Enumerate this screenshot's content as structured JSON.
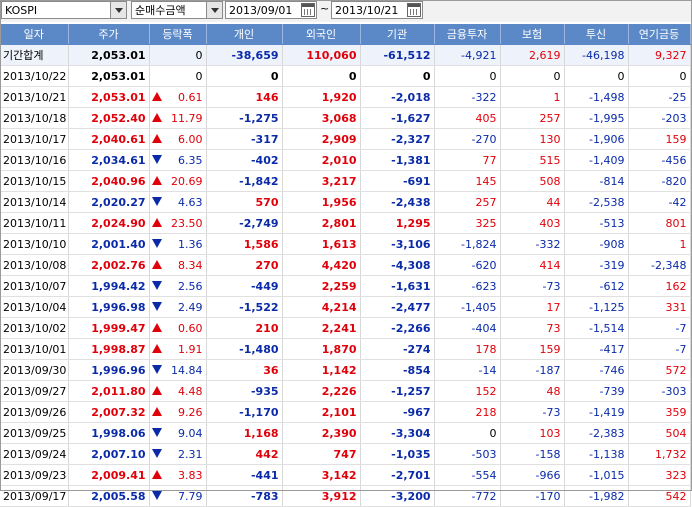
{
  "toolbar": {
    "market": "KOSPI",
    "type": "순매수금액",
    "start_date": "2013/09/01",
    "end_date": "2013/10/21",
    "separator": "~"
  },
  "columns": [
    "일자",
    "주가",
    "등락폭",
    "개인",
    "외국인",
    "기관",
    "금융투자",
    "보험",
    "투신",
    "연기금등"
  ],
  "colors": {
    "up": "#e0000a",
    "down": "#0a2aa8",
    "header": "#5b88c6"
  },
  "rows": [
    {
      "date": "기간합계",
      "price": "2,053.01",
      "dir": "",
      "chg": "0",
      "ind": "-38,659",
      "frn": "110,060",
      "inst": "-61,512",
      "fin": "-4,921",
      "ins": "2,619",
      "trust": "-46,198",
      "pens": "9,327"
    },
    {
      "date": "2013/10/22",
      "price": "2,053.01",
      "dir": "",
      "chg": "0",
      "ind": "0",
      "frn": "0",
      "inst": "0",
      "fin": "0",
      "ins": "0",
      "trust": "0",
      "pens": "0"
    },
    {
      "date": "2013/10/21",
      "price": "2,053.01",
      "dir": "up",
      "chg": "0.61",
      "ind": "146",
      "frn": "1,920",
      "inst": "-2,018",
      "fin": "-322",
      "ins": "1",
      "trust": "-1,498",
      "pens": "-25"
    },
    {
      "date": "2013/10/18",
      "price": "2,052.40",
      "dir": "up",
      "chg": "11.79",
      "ind": "-1,275",
      "frn": "3,068",
      "inst": "-1,627",
      "fin": "405",
      "ins": "257",
      "trust": "-1,995",
      "pens": "-203"
    },
    {
      "date": "2013/10/17",
      "price": "2,040.61",
      "dir": "up",
      "chg": "6.00",
      "ind": "-317",
      "frn": "2,909",
      "inst": "-2,327",
      "fin": "-270",
      "ins": "130",
      "trust": "-1,906",
      "pens": "159"
    },
    {
      "date": "2013/10/16",
      "price": "2,034.61",
      "dir": "down",
      "chg": "6.35",
      "ind": "-402",
      "frn": "2,010",
      "inst": "-1,381",
      "fin": "77",
      "ins": "515",
      "trust": "-1,409",
      "pens": "-456"
    },
    {
      "date": "2013/10/15",
      "price": "2,040.96",
      "dir": "up",
      "chg": "20.69",
      "ind": "-1,842",
      "frn": "3,217",
      "inst": "-691",
      "fin": "145",
      "ins": "508",
      "trust": "-814",
      "pens": "-820"
    },
    {
      "date": "2013/10/14",
      "price": "2,020.27",
      "dir": "down",
      "chg": "4.63",
      "ind": "570",
      "frn": "1,956",
      "inst": "-2,438",
      "fin": "257",
      "ins": "44",
      "trust": "-2,538",
      "pens": "-42"
    },
    {
      "date": "2013/10/11",
      "price": "2,024.90",
      "dir": "up",
      "chg": "23.50",
      "ind": "-2,749",
      "frn": "2,801",
      "inst": "1,295",
      "fin": "325",
      "ins": "403",
      "trust": "-513",
      "pens": "801"
    },
    {
      "date": "2013/10/10",
      "price": "2,001.40",
      "dir": "down",
      "chg": "1.36",
      "ind": "1,586",
      "frn": "1,613",
      "inst": "-3,106",
      "fin": "-1,824",
      "ins": "-332",
      "trust": "-908",
      "pens": "1"
    },
    {
      "date": "2013/10/08",
      "price": "2,002.76",
      "dir": "up",
      "chg": "8.34",
      "ind": "270",
      "frn": "4,420",
      "inst": "-4,308",
      "fin": "-620",
      "ins": "414",
      "trust": "-319",
      "pens": "-2,348"
    },
    {
      "date": "2013/10/07",
      "price": "1,994.42",
      "dir": "down",
      "chg": "2.56",
      "ind": "-449",
      "frn": "2,259",
      "inst": "-1,631",
      "fin": "-623",
      "ins": "-73",
      "trust": "-612",
      "pens": "162"
    },
    {
      "date": "2013/10/04",
      "price": "1,996.98",
      "dir": "down",
      "chg": "2.49",
      "ind": "-1,522",
      "frn": "4,214",
      "inst": "-2,477",
      "fin": "-1,405",
      "ins": "17",
      "trust": "-1,125",
      "pens": "331"
    },
    {
      "date": "2013/10/02",
      "price": "1,999.47",
      "dir": "up",
      "chg": "0.60",
      "ind": "210",
      "frn": "2,241",
      "inst": "-2,266",
      "fin": "-404",
      "ins": "73",
      "trust": "-1,514",
      "pens": "-7"
    },
    {
      "date": "2013/10/01",
      "price": "1,998.87",
      "dir": "up",
      "chg": "1.91",
      "ind": "-1,480",
      "frn": "1,870",
      "inst": "-274",
      "fin": "178",
      "ins": "159",
      "trust": "-417",
      "pens": "-7"
    },
    {
      "date": "2013/09/30",
      "price": "1,996.96",
      "dir": "down",
      "chg": "14.84",
      "ind": "36",
      "frn": "1,142",
      "inst": "-854",
      "fin": "-14",
      "ins": "-187",
      "trust": "-746",
      "pens": "572"
    },
    {
      "date": "2013/09/27",
      "price": "2,011.80",
      "dir": "up",
      "chg": "4.48",
      "ind": "-935",
      "frn": "2,226",
      "inst": "-1,257",
      "fin": "152",
      "ins": "48",
      "trust": "-739",
      "pens": "-303"
    },
    {
      "date": "2013/09/26",
      "price": "2,007.32",
      "dir": "up",
      "chg": "9.26",
      "ind": "-1,170",
      "frn": "2,101",
      "inst": "-967",
      "fin": "218",
      "ins": "-73",
      "trust": "-1,419",
      "pens": "359"
    },
    {
      "date": "2013/09/25",
      "price": "1,998.06",
      "dir": "down",
      "chg": "9.04",
      "ind": "1,168",
      "frn": "2,390",
      "inst": "-3,304",
      "fin": "0",
      "ins": "103",
      "trust": "-2,383",
      "pens": "504"
    },
    {
      "date": "2013/09/24",
      "price": "2,007.10",
      "dir": "down",
      "chg": "2.31",
      "ind": "442",
      "frn": "747",
      "inst": "-1,035",
      "fin": "-503",
      "ins": "-158",
      "trust": "-1,138",
      "pens": "1,732"
    },
    {
      "date": "2013/09/23",
      "price": "2,009.41",
      "dir": "up",
      "chg": "3.83",
      "ind": "-441",
      "frn": "3,142",
      "inst": "-2,701",
      "fin": "-554",
      "ins": "-966",
      "trust": "-1,015",
      "pens": "323"
    },
    {
      "date": "2013/09/17",
      "price": "2,005.58",
      "dir": "down",
      "chg": "7.79",
      "ind": "-783",
      "frn": "3,912",
      "inst": "-3,200",
      "fin": "-772",
      "ins": "-170",
      "trust": "-1,982",
      "pens": "542"
    }
  ]
}
